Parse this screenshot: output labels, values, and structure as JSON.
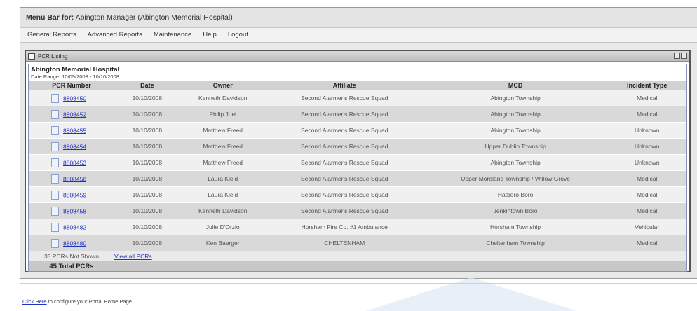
{
  "menubar": {
    "label": "Menu Bar for:",
    "context": "Abington Manager (Abington Memorial Hospital)"
  },
  "nav": [
    "General Reports",
    "Advanced Reports",
    "Maintenance",
    "Help",
    "Logout"
  ],
  "panel": {
    "title": "PCR Listing"
  },
  "listing": {
    "org": "Abington Memorial Hospital",
    "date_range": "Date Range: 10/09/2008 - 10/10/2008",
    "columns": [
      "PCR Number",
      "Date",
      "Owner",
      "Affiliate",
      "MCD",
      "Incident Type"
    ],
    "info_glyph": "i",
    "rows": [
      {
        "pcr": "8808450",
        "date": "10/10/2008",
        "owner": "Kenneth Davidson",
        "affiliate": "Second Alarmer's Rescue Squad",
        "mcd": "Abington Township",
        "type": "Medical"
      },
      {
        "pcr": "8808452",
        "date": "10/10/2008",
        "owner": "Philip Juel",
        "affiliate": "Second Alarmer's Rescue Squad",
        "mcd": "Abington Township",
        "type": "Medical"
      },
      {
        "pcr": "8808455",
        "date": "10/10/2008",
        "owner": "Matthew Freed",
        "affiliate": "Second Alarmer's Rescue Squad",
        "mcd": "Abington Township",
        "type": "Unknown"
      },
      {
        "pcr": "8808454",
        "date": "10/10/2008",
        "owner": "Matthew Freed",
        "affiliate": "Second Alarmer's Rescue Squad",
        "mcd": "Upper Dublin Township",
        "type": "Unknown"
      },
      {
        "pcr": "8808453",
        "date": "10/10/2008",
        "owner": "Matthew Freed",
        "affiliate": "Second Alarmer's Rescue Squad",
        "mcd": "Abington Township",
        "type": "Unknown"
      },
      {
        "pcr": "8808456",
        "date": "10/10/2008",
        "owner": "Laura Kleid",
        "affiliate": "Second Alarmer's Rescue Squad",
        "mcd": "Upper Moreland Township / Willow Grove",
        "type": "Medical"
      },
      {
        "pcr": "8808459",
        "date": "10/10/2008",
        "owner": "Laura Kleid",
        "affiliate": "Second Alarmer's Rescue Squad",
        "mcd": "Hatboro Boro",
        "type": "Medical"
      },
      {
        "pcr": "8808458",
        "date": "10/10/2008",
        "owner": "Kenneth Davidson",
        "affiliate": "Second Alarmer's Rescue Squad",
        "mcd": "Jenkintown Boro",
        "type": "Medical"
      },
      {
        "pcr": "8808482",
        "date": "10/10/2008",
        "owner": "Julie D'Orzio",
        "affiliate": "Horsham Fire Co. #1 Ambulance",
        "mcd": "Horsham Township",
        "type": "Vehicular"
      },
      {
        "pcr": "8808480",
        "date": "10/10/2008",
        "owner": "Ken Baerger",
        "affiliate": "CHELTENHAM",
        "mcd": "Cheltenham Township",
        "type": "Medical"
      }
    ],
    "not_shown": "35 PCRs Not Shown",
    "view_all": "View all PCRs",
    "total": "45 Total PCRs"
  },
  "footer": {
    "link": "Click Here",
    "text": " to configure your Portal Home Page"
  }
}
